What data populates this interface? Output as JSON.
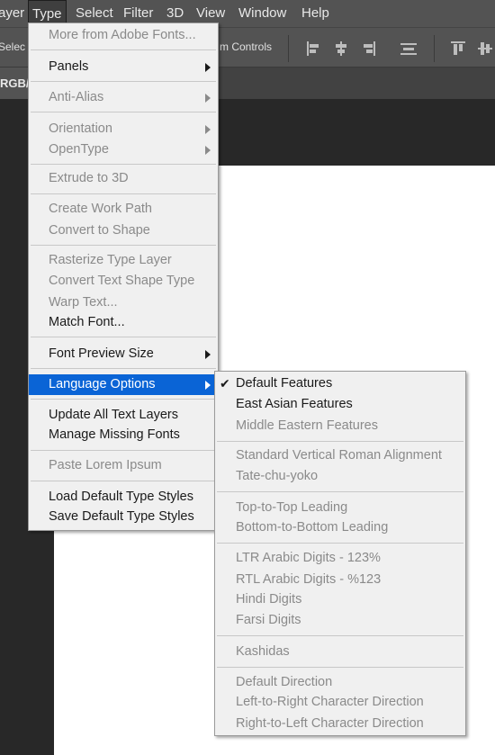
{
  "menubar": {
    "items": [
      "ayer",
      "Type",
      "Select",
      "Filter",
      "3D",
      "View",
      "Window",
      "Help"
    ],
    "active": "Type"
  },
  "optionsbar": {
    "left_text": "Selec",
    "controls_text": "m Controls"
  },
  "document": {
    "tab_text": "RGB/"
  },
  "type_menu": [
    {
      "label": "More from Adobe Fonts...",
      "enabled": false
    },
    {
      "label": "Panels",
      "enabled": true,
      "submenu": true
    },
    {
      "label": "Anti-Alias",
      "enabled": false,
      "submenu": true
    },
    {
      "label": "Orientation",
      "enabled": false,
      "submenu": true
    },
    {
      "label": "OpenType",
      "enabled": false,
      "submenu": true
    },
    {
      "label": "Extrude to 3D",
      "enabled": false
    },
    {
      "label": "Create Work Path",
      "enabled": false
    },
    {
      "label": "Convert to Shape",
      "enabled": false
    },
    {
      "label": "Rasterize Type Layer",
      "enabled": false
    },
    {
      "label": "Convert Text Shape Type",
      "enabled": false
    },
    {
      "label": "Warp Text...",
      "enabled": false
    },
    {
      "label": "Match Font...",
      "enabled": true
    },
    {
      "label": "Font Preview Size",
      "enabled": true,
      "submenu": true
    },
    {
      "label": "Language Options",
      "enabled": true,
      "submenu": true,
      "highlighted": true
    },
    {
      "label": "Update All Text Layers",
      "enabled": true
    },
    {
      "label": "Manage Missing Fonts",
      "enabled": true
    },
    {
      "label": "Paste Lorem Ipsum",
      "enabled": false
    },
    {
      "label": "Load Default Type Styles",
      "enabled": true
    },
    {
      "label": "Save Default Type Styles",
      "enabled": true
    }
  ],
  "language_submenu": [
    {
      "label": "Default Features",
      "enabled": true,
      "checked": true
    },
    {
      "label": "East Asian Features",
      "enabled": true
    },
    {
      "label": "Middle Eastern Features",
      "enabled": false
    },
    {
      "label": "Standard Vertical Roman Alignment",
      "enabled": false
    },
    {
      "label": "Tate-chu-yoko",
      "enabled": false
    },
    {
      "label": "Top-to-Top Leading",
      "enabled": false
    },
    {
      "label": "Bottom-to-Bottom Leading",
      "enabled": false
    },
    {
      "label": "LTR Arabic Digits - 123%",
      "enabled": false
    },
    {
      "label": "RTL Arabic Digits - %123",
      "enabled": false
    },
    {
      "label": "Hindi Digits",
      "enabled": false
    },
    {
      "label": "Farsi Digits",
      "enabled": false
    },
    {
      "label": "Kashidas",
      "enabled": false
    },
    {
      "label": "Default Direction",
      "enabled": false
    },
    {
      "label": "Left-to-Right Character Direction",
      "enabled": false
    },
    {
      "label": "Right-to-Left Character Direction",
      "enabled": false
    }
  ],
  "colors": {
    "highlight": "#0a64d6",
    "menu_bg": "#f0f0f0",
    "app_bg": "#535353",
    "canvas": "#ffffff"
  }
}
